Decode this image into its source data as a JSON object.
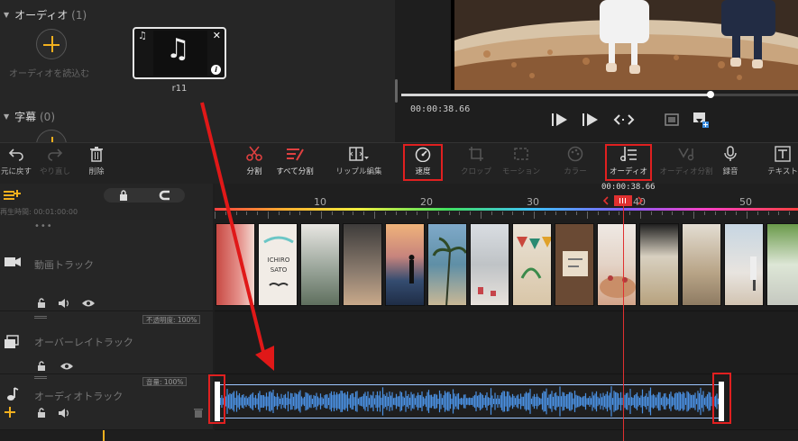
{
  "library": {
    "audio_header": "オーディオ",
    "audio_count": "(1)",
    "import_audio_label": "オーディオを読込む",
    "media_item_name": "r11",
    "subtitle_header": "字幕",
    "subtitle_count": "(0)"
  },
  "preview": {
    "timecode": "00:00:38.66",
    "progress": 0.78
  },
  "toolbar": {
    "undo": "元に戻す",
    "redo": "やり直し",
    "delete": "削除",
    "split": "分割",
    "split_all": "すべて分割",
    "ripple_edit": "リップル編集",
    "speed": "速度",
    "crop": "クロップ",
    "motion": "モーション",
    "color": "カラー",
    "audio": "オーディオ",
    "audio_split": "オーディオ分割",
    "record": "録音",
    "text": "テキスト"
  },
  "timeline": {
    "playback_time_label": "再生時間: 00:01:00:00",
    "playhead_time": "00:00:38.66",
    "ruler_labels": [
      "10",
      "20",
      "30",
      "40",
      "50"
    ],
    "tracks": {
      "video": "動画トラック",
      "overlay": "オーバーレイトラック",
      "audio": "オーディオトラック"
    },
    "opacity_badge": "不透明度: 100%",
    "volume_badge": "音量: 100%"
  },
  "colors": {
    "accent_yellow": "#f2b01e",
    "highlight_red": "#e02020",
    "waveform_blue": "#4a90e2",
    "playhead_red": "#e03030"
  }
}
